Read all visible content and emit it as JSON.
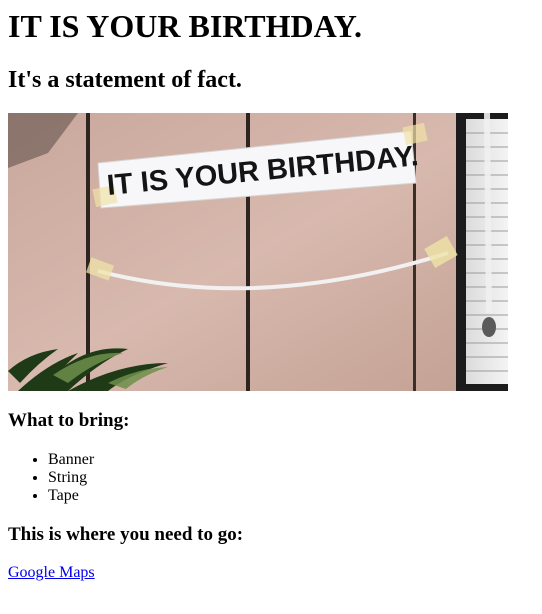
{
  "page": {
    "title": "IT IS YOUR BIRTHDAY.",
    "subtitle": "It's a statement of fact."
  },
  "image": {
    "banner_text": "IT IS YOUR BIRTHDAY.",
    "icon": "photo-birthday-banner"
  },
  "bring": {
    "heading": "What to bring:",
    "items": [
      "Banner",
      "String",
      "Tape"
    ]
  },
  "directions": {
    "heading": "This is where you need to go:",
    "link_label": "Google Maps"
  }
}
